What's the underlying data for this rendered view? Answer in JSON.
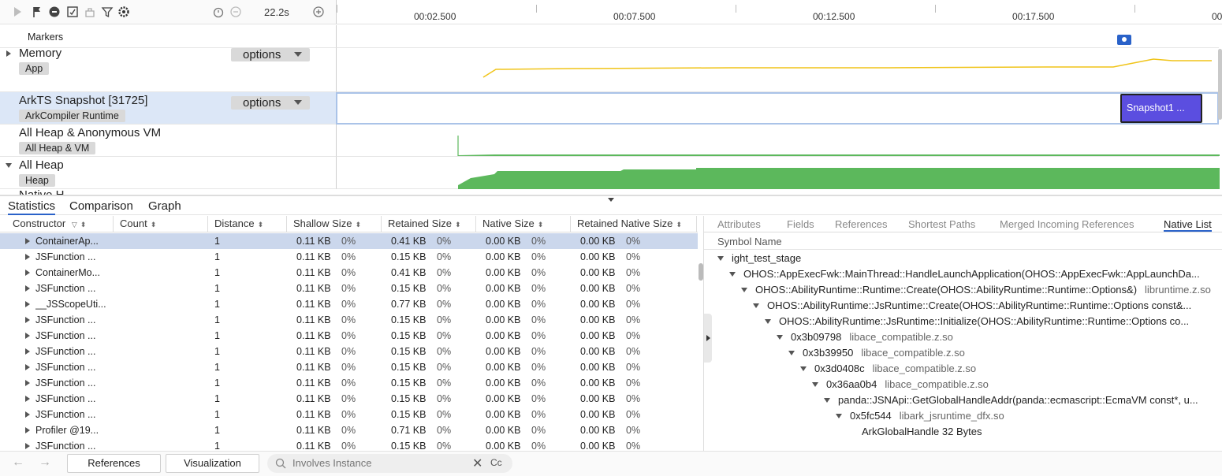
{
  "toolbar": {
    "duration": "22.2s"
  },
  "timeline": {
    "ticks": [
      "00:02.500",
      "00:07.500",
      "00:12.500",
      "00:17.500",
      "00"
    ]
  },
  "tracks": {
    "markers": "Markers",
    "memory": {
      "title": "Memory",
      "tag": "App",
      "options": "options"
    },
    "snapshot": {
      "title": "ArkTS Snapshot [31725]",
      "tag": "ArkCompiler Runtime",
      "options": "options",
      "block": "Snapshot1 ..."
    },
    "heap_vm": {
      "title": "All Heap & Anonymous VM",
      "tag": "All Heap & VM"
    },
    "all_heap": {
      "title": "All Heap",
      "tag": "Heap"
    },
    "cut_label": "Native H..."
  },
  "lower_tabs": [
    "Statistics",
    "Comparison",
    "Graph"
  ],
  "columns": {
    "constructor": "Constructor",
    "count": "Count",
    "distance": "Distance",
    "shallow": "Shallow Size",
    "retained": "Retained Size",
    "native": "Native Size",
    "retained_native": "Retained Native Size"
  },
  "rows": [
    {
      "name": "ContainerAp...",
      "count": "",
      "distance": "1",
      "shallow": "0.11 KB",
      "shallow_pct": "0%",
      "retained": "0.41 KB",
      "retained_pct": "0%",
      "native": "0.00 KB",
      "native_pct": "0%",
      "rnative": "0.00 KB",
      "rnative_pct": "0%"
    },
    {
      "name": "JSFunction ...",
      "count": "",
      "distance": "1",
      "shallow": "0.11 KB",
      "shallow_pct": "0%",
      "retained": "0.15 KB",
      "retained_pct": "0%",
      "native": "0.00 KB",
      "native_pct": "0%",
      "rnative": "0.00 KB",
      "rnative_pct": "0%"
    },
    {
      "name": "ContainerMo...",
      "count": "",
      "distance": "1",
      "shallow": "0.11 KB",
      "shallow_pct": "0%",
      "retained": "0.41 KB",
      "retained_pct": "0%",
      "native": "0.00 KB",
      "native_pct": "0%",
      "rnative": "0.00 KB",
      "rnative_pct": "0%"
    },
    {
      "name": "JSFunction ...",
      "count": "",
      "distance": "1",
      "shallow": "0.11 KB",
      "shallow_pct": "0%",
      "retained": "0.15 KB",
      "retained_pct": "0%",
      "native": "0.00 KB",
      "native_pct": "0%",
      "rnative": "0.00 KB",
      "rnative_pct": "0%"
    },
    {
      "name": "__JSScopeUti...",
      "count": "",
      "distance": "1",
      "shallow": "0.11 KB",
      "shallow_pct": "0%",
      "retained": "0.77 KB",
      "retained_pct": "0%",
      "native": "0.00 KB",
      "native_pct": "0%",
      "rnative": "0.00 KB",
      "rnative_pct": "0%"
    },
    {
      "name": "JSFunction ...",
      "count": "",
      "distance": "1",
      "shallow": "0.11 KB",
      "shallow_pct": "0%",
      "retained": "0.15 KB",
      "retained_pct": "0%",
      "native": "0.00 KB",
      "native_pct": "0%",
      "rnative": "0.00 KB",
      "rnative_pct": "0%"
    },
    {
      "name": "JSFunction ...",
      "count": "",
      "distance": "1",
      "shallow": "0.11 KB",
      "shallow_pct": "0%",
      "retained": "0.15 KB",
      "retained_pct": "0%",
      "native": "0.00 KB",
      "native_pct": "0%",
      "rnative": "0.00 KB",
      "rnative_pct": "0%"
    },
    {
      "name": "JSFunction ...",
      "count": "",
      "distance": "1",
      "shallow": "0.11 KB",
      "shallow_pct": "0%",
      "retained": "0.15 KB",
      "retained_pct": "0%",
      "native": "0.00 KB",
      "native_pct": "0%",
      "rnative": "0.00 KB",
      "rnative_pct": "0%"
    },
    {
      "name": "JSFunction ...",
      "count": "",
      "distance": "1",
      "shallow": "0.11 KB",
      "shallow_pct": "0%",
      "retained": "0.15 KB",
      "retained_pct": "0%",
      "native": "0.00 KB",
      "native_pct": "0%",
      "rnative": "0.00 KB",
      "rnative_pct": "0%"
    },
    {
      "name": "JSFunction ...",
      "count": "",
      "distance": "1",
      "shallow": "0.11 KB",
      "shallow_pct": "0%",
      "retained": "0.15 KB",
      "retained_pct": "0%",
      "native": "0.00 KB",
      "native_pct": "0%",
      "rnative": "0.00 KB",
      "rnative_pct": "0%"
    },
    {
      "name": "JSFunction ...",
      "count": "",
      "distance": "1",
      "shallow": "0.11 KB",
      "shallow_pct": "0%",
      "retained": "0.15 KB",
      "retained_pct": "0%",
      "native": "0.00 KB",
      "native_pct": "0%",
      "rnative": "0.00 KB",
      "rnative_pct": "0%"
    },
    {
      "name": "JSFunction ...",
      "count": "",
      "distance": "1",
      "shallow": "0.11 KB",
      "shallow_pct": "0%",
      "retained": "0.15 KB",
      "retained_pct": "0%",
      "native": "0.00 KB",
      "native_pct": "0%",
      "rnative": "0.00 KB",
      "rnative_pct": "0%"
    },
    {
      "name": "Profiler @19...",
      "count": "",
      "distance": "1",
      "shallow": "0.11 KB",
      "shallow_pct": "0%",
      "retained": "0.71 KB",
      "retained_pct": "0%",
      "native": "0.00 KB",
      "native_pct": "0%",
      "rnative": "0.00 KB",
      "rnative_pct": "0%"
    },
    {
      "name": "JSFunction ...",
      "count": "",
      "distance": "1",
      "shallow": "0.11 KB",
      "shallow_pct": "0%",
      "retained": "0.15 KB",
      "retained_pct": "0%",
      "native": "0.00 KB",
      "native_pct": "0%",
      "rnative": "0.00 KB",
      "rnative_pct": "0%"
    }
  ],
  "right_tabs": [
    "Attributes",
    "Fields",
    "References",
    "Shortest Paths",
    "Merged Incoming References",
    "Native List"
  ],
  "symbol_header": "Symbol Name",
  "native_tree": [
    {
      "sym": "ight_test_stage",
      "lib": ""
    },
    {
      "sym": "OHOS::AppExecFwk::MainThread::HandleLaunchApplication(OHOS::AppExecFwk::AppLaunchDa...",
      "lib": ""
    },
    {
      "sym": "OHOS::AbilityRuntime::Runtime::Create(OHOS::AbilityRuntime::Runtime::Options&)",
      "lib": "libruntime.z.so"
    },
    {
      "sym": "OHOS::AbilityRuntime::JsRuntime::Create(OHOS::AbilityRuntime::Runtime::Options const&...",
      "lib": ""
    },
    {
      "sym": "OHOS::AbilityRuntime::JsRuntime::Initialize(OHOS::AbilityRuntime::Runtime::Options co...",
      "lib": ""
    },
    {
      "sym": "0x3b09798",
      "lib": "libace_compatible.z.so"
    },
    {
      "sym": "0x3b39950",
      "lib": "libace_compatible.z.so"
    },
    {
      "sym": "0x3d0408c",
      "lib": "libace_compatible.z.so"
    },
    {
      "sym": "0x36aa0b4",
      "lib": "libace_compatible.z.so"
    },
    {
      "sym": "panda::JSNApi::GetGlobalHandleAddr(panda::ecmascript::EcmaVM const*, u...",
      "lib": ""
    },
    {
      "sym": "0x5fc544",
      "lib": "libark_jsruntime_dfx.so"
    },
    {
      "sym": "ArkGlobalHandle 32 Bytes",
      "lib": ""
    }
  ],
  "bottom": {
    "references_btn": "References",
    "visualization_btn": "Visualization",
    "search_placeholder": "Involves Instance",
    "case_btn": "Cc"
  },
  "colors": {
    "accent": "#2a62c9",
    "memory_line": "#f0c419",
    "heap_fill": "#5cb85c",
    "snapshot_block": "#5b4ee0"
  }
}
